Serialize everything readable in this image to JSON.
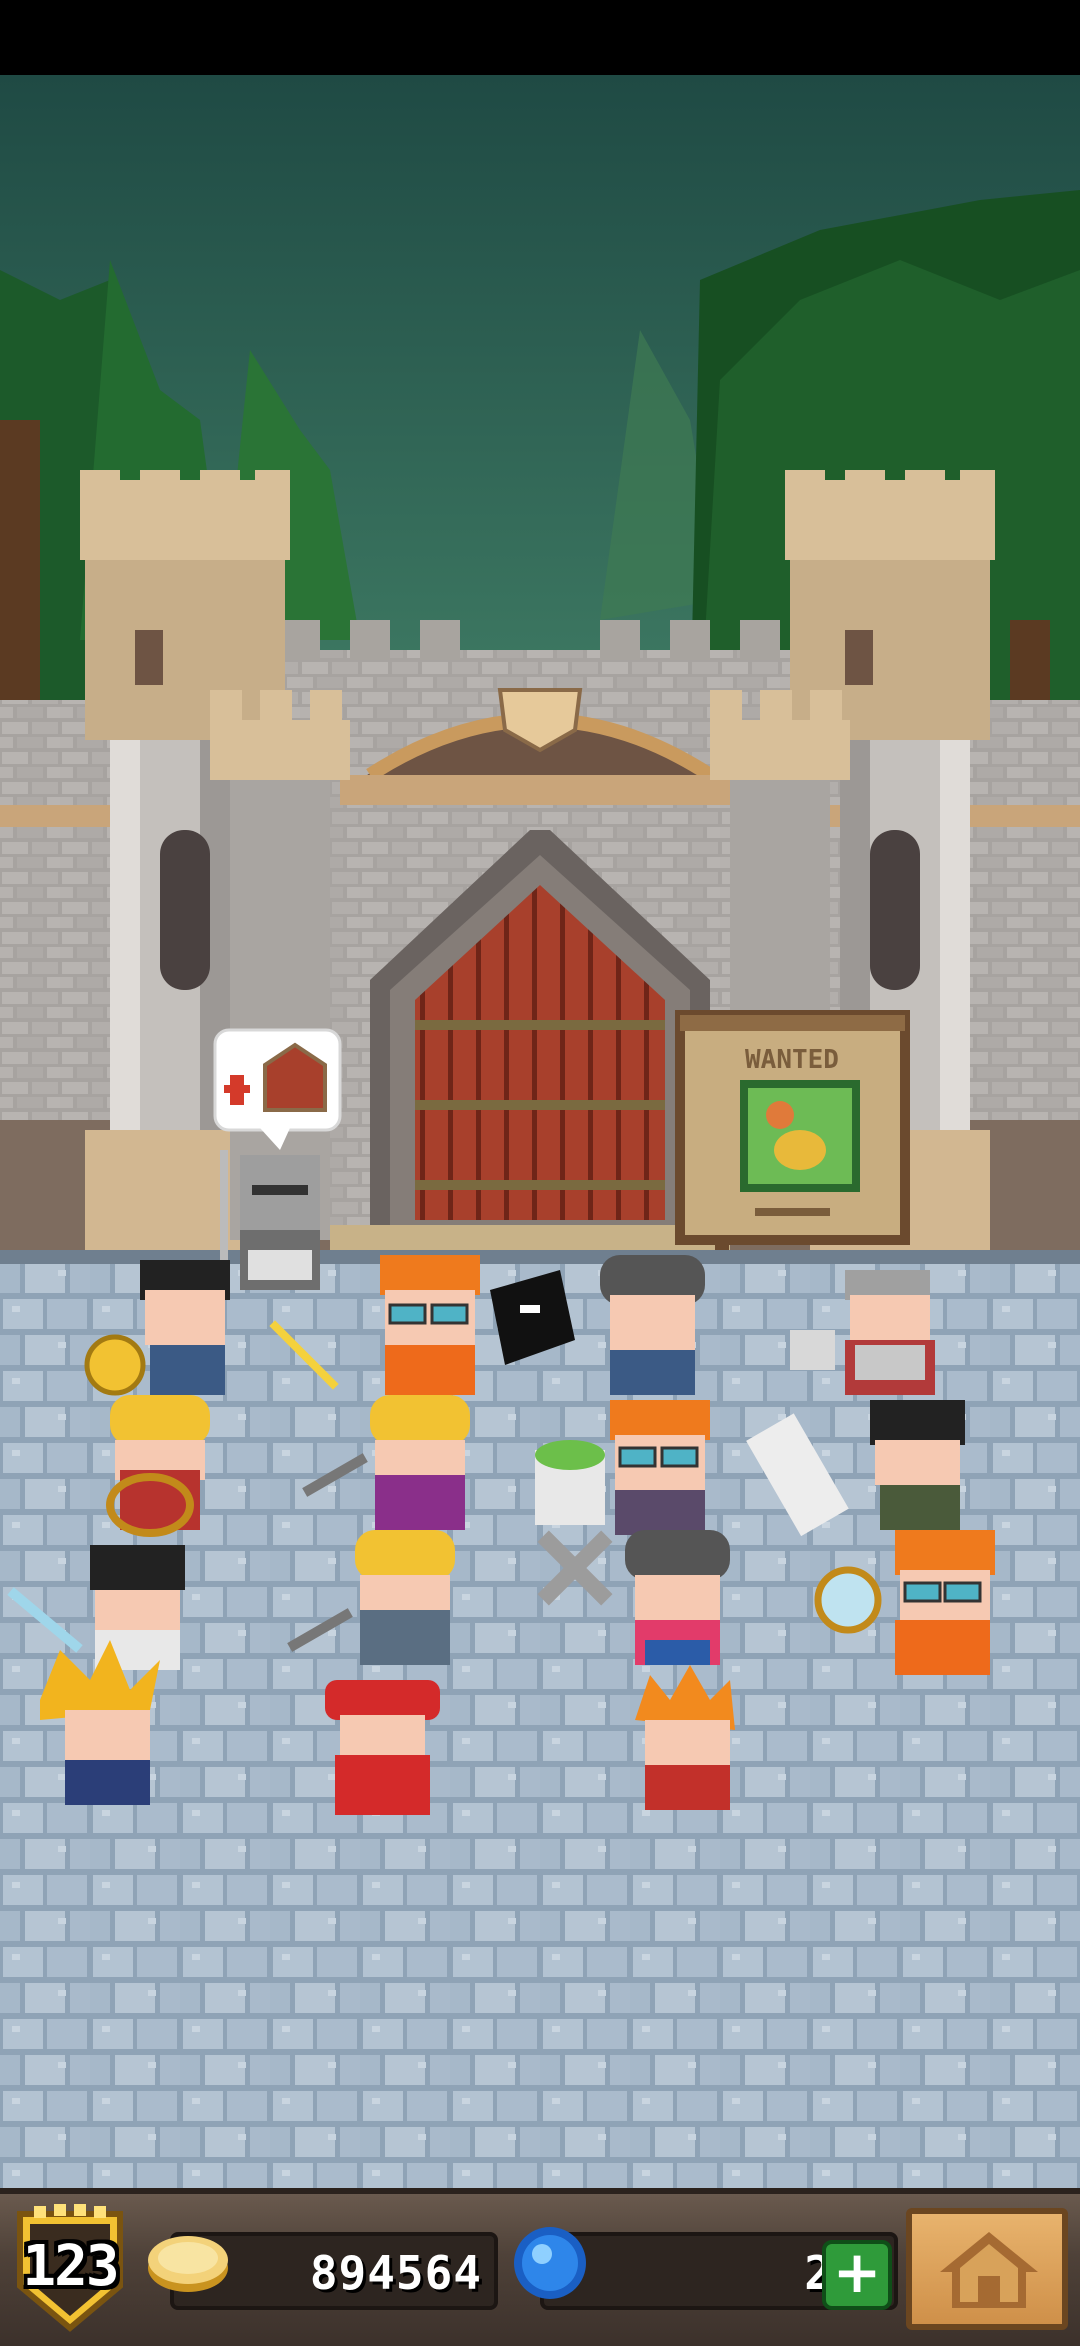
{
  "hud": {
    "level": "123",
    "coins": "894564",
    "gems": "2",
    "add_gems_label": "+"
  },
  "scene": {
    "wanted_poster_title": "WANTED"
  },
  "colors": {
    "sky_top": "#1f4a44",
    "floor": "#a9b9c8",
    "hud_bg": "#4f4239",
    "gem_plus_green": "#2f9b3a"
  },
  "icons": [
    "shield-level-icon",
    "gold-coin-icon",
    "blue-gem-icon",
    "plus-icon",
    "home-icon",
    "gate-speech-bubble-icon",
    "wanted-poster"
  ]
}
